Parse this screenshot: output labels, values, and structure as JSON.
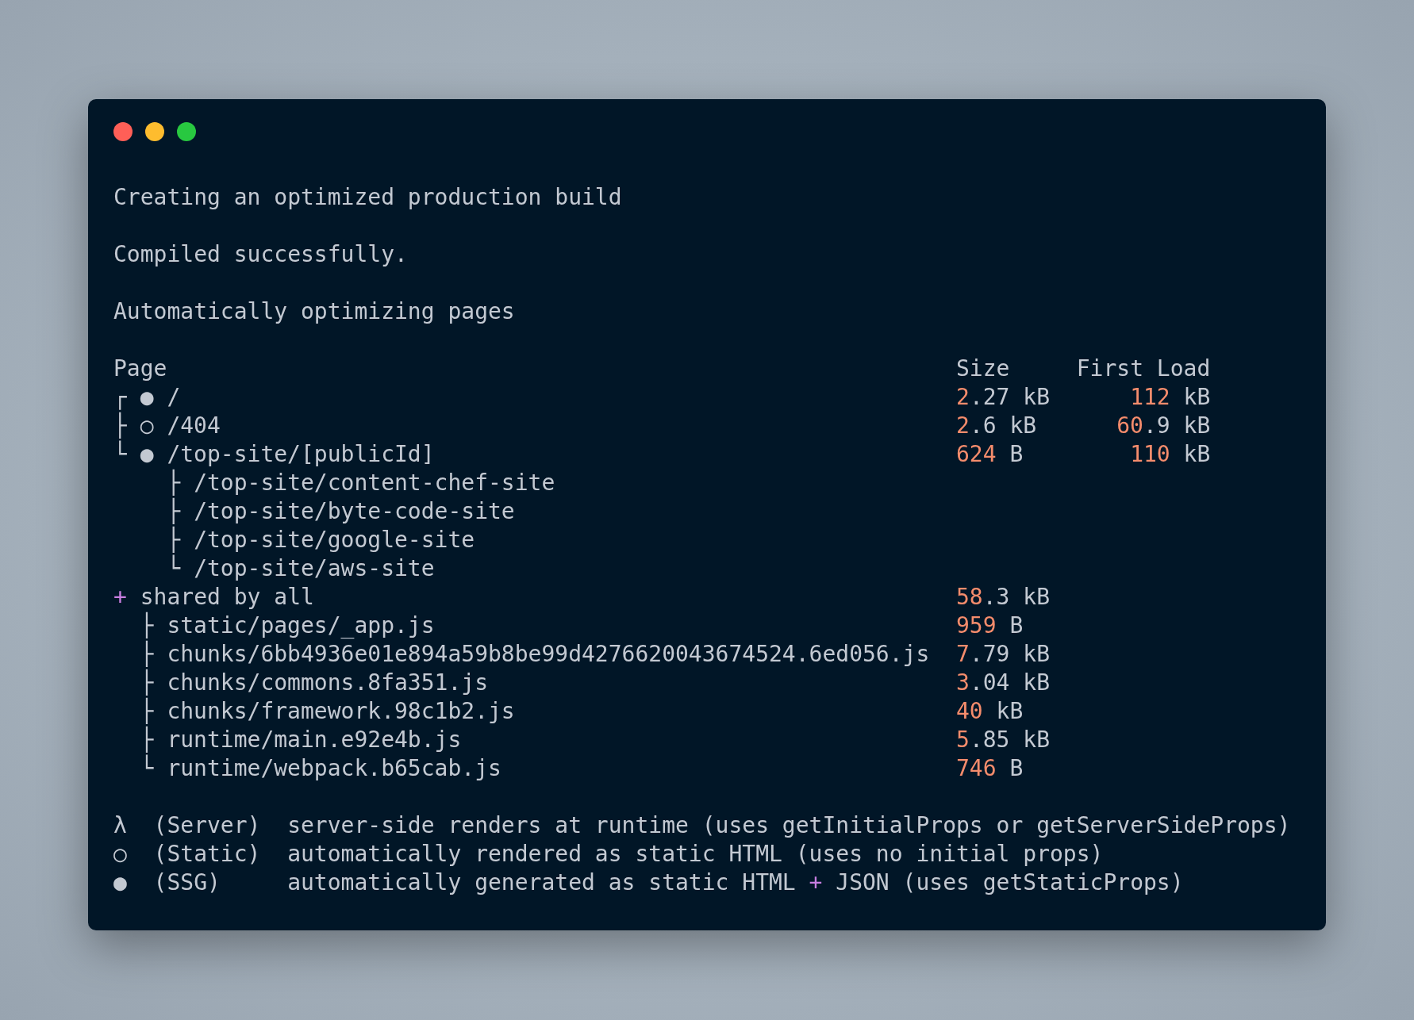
{
  "messages": [
    "Creating an optimized production build",
    "Compiled successfully.",
    "Automatically optimizing pages"
  ],
  "table": {
    "header": {
      "page": "Page",
      "size": "Size",
      "first_load": "First Load"
    },
    "routes": [
      {
        "branch": "┌",
        "symbol": "●",
        "path": "/",
        "size": {
          "lead": "2",
          "rest": ".27 kB"
        },
        "first_load": {
          "lead": "112",
          "rest": " kB"
        }
      },
      {
        "branch": "├",
        "symbol": "○",
        "path": "/404",
        "size": {
          "lead": "2",
          "rest": ".6 kB"
        },
        "first_load": {
          "lead": "60",
          "rest": ".9 kB"
        }
      },
      {
        "branch": "└",
        "symbol": "●",
        "path": "/top-site/[publicId]",
        "size": {
          "lead": "624",
          "rest": " B"
        },
        "first_load": {
          "lead": "110",
          "rest": " kB"
        },
        "children": [
          {
            "branch": "├",
            "path": "/top-site/content-chef-site"
          },
          {
            "branch": "├",
            "path": "/top-site/byte-code-site"
          },
          {
            "branch": "├",
            "path": "/top-site/google-site"
          },
          {
            "branch": "└",
            "path": "/top-site/aws-site"
          }
        ]
      }
    ],
    "shared": {
      "marker": "+",
      "label": "shared by all",
      "size": {
        "lead": "58",
        "rest": ".3 kB"
      },
      "files": [
        {
          "branch": "├",
          "path": "static/pages/_app.js",
          "size": {
            "lead": "959",
            "rest": " B"
          }
        },
        {
          "branch": "├",
          "path": "chunks/6bb4936e01e894a59b8be99d4276620043674524.6ed056.js",
          "size": {
            "lead": "7",
            "rest": ".79 kB"
          }
        },
        {
          "branch": "├",
          "path": "chunks/commons.8fa351.js",
          "size": {
            "lead": "3",
            "rest": ".04 kB"
          }
        },
        {
          "branch": "├",
          "path": "chunks/framework.98c1b2.js",
          "size": {
            "lead": "40",
            "rest": " kB"
          }
        },
        {
          "branch": "├",
          "path": "runtime/main.e92e4b.js",
          "size": {
            "lead": "5",
            "rest": ".85 kB"
          }
        },
        {
          "branch": "└",
          "path": "runtime/webpack.b65cab.js",
          "size": {
            "lead": "746",
            "rest": " B"
          }
        }
      ]
    }
  },
  "legend": [
    {
      "symbol": "λ",
      "label": "(Server)",
      "parts": [
        {
          "text": "server-side renders at runtime (uses getInitialProps or getServerSideProps)",
          "accent": false
        }
      ]
    },
    {
      "symbol": "○",
      "label": "(Static)",
      "parts": [
        {
          "text": "automatically rendered as static HTML (uses no initial props)",
          "accent": false
        }
      ]
    },
    {
      "symbol": "●",
      "label": "(SSG)",
      "parts": [
        {
          "text": "automatically generated as static HTML ",
          "accent": false
        },
        {
          "text": "+",
          "accent": true
        },
        {
          "text": " JSON (uses getStaticProps)",
          "accent": false
        }
      ]
    }
  ]
}
